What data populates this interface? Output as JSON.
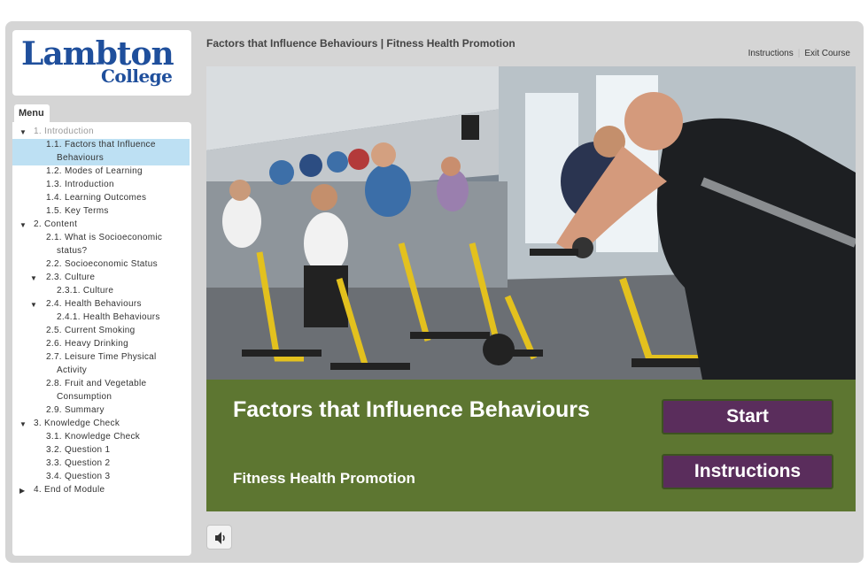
{
  "logo": {
    "line1": "Lambton",
    "line2": "College"
  },
  "menu": {
    "tab_label": "Menu",
    "items": [
      {
        "label": "1. Introduction",
        "level": 1,
        "arrow": "▼",
        "dim": true
      },
      {
        "label": "1.1. Factors that Influence",
        "level": 2,
        "active": true
      },
      {
        "label": "Behaviours",
        "level": 3,
        "cont": true,
        "active": true
      },
      {
        "label": "1.2. Modes of Learning",
        "level": 2
      },
      {
        "label": "1.3. Introduction",
        "level": 2
      },
      {
        "label": "1.4. Learning Outcomes",
        "level": 2
      },
      {
        "label": "1.5. Key Terms",
        "level": 2
      },
      {
        "label": "2. Content",
        "level": 1,
        "arrow": "▼"
      },
      {
        "label": "2.1. What is Socioeconomic",
        "level": 2
      },
      {
        "label": "status?",
        "level": 3,
        "cont": true
      },
      {
        "label": "2.2. Socioeconomic Status",
        "level": 2
      },
      {
        "label": "2.3. Culture",
        "level": 2,
        "arrow": "▼",
        "sub": true
      },
      {
        "label": "2.3.1. Culture",
        "level": 3
      },
      {
        "label": "2.4. Health Behaviours",
        "level": 2,
        "arrow": "▼",
        "sub": true
      },
      {
        "label": "2.4.1. Health Behaviours",
        "level": 3
      },
      {
        "label": "2.5. Current Smoking",
        "level": 2
      },
      {
        "label": "2.6. Heavy Drinking",
        "level": 2
      },
      {
        "label": "2.7. Leisure Time Physical",
        "level": 2
      },
      {
        "label": "Activity",
        "level": 3,
        "cont": true
      },
      {
        "label": "2.8. Fruit and Vegetable",
        "level": 2
      },
      {
        "label": "Consumption",
        "level": 3,
        "cont": true
      },
      {
        "label": "2.9. Summary",
        "level": 2
      },
      {
        "label": "3. Knowledge Check",
        "level": 1,
        "arrow": "▼"
      },
      {
        "label": "3.1. Knowledge Check",
        "level": 2
      },
      {
        "label": "3.2. Question 1",
        "level": 2
      },
      {
        "label": "3.3. Question 2",
        "level": 2
      },
      {
        "label": "3.4. Question 3",
        "level": 2
      },
      {
        "label": "4. End of Module",
        "level": 1,
        "arrow": "▶"
      }
    ]
  },
  "header": {
    "course_title": "Factors that Influence Behaviours | Fitness Health Promotion",
    "instructions_link": "Instructions",
    "exit_link": "Exit Course"
  },
  "slide": {
    "title": "Factors that Influence Behaviours",
    "subtitle": "Fitness Health Promotion",
    "start_label": "Start",
    "instructions_label": "Instructions"
  },
  "colors": {
    "banner": "#5d7631",
    "button": "#5a2d5c",
    "logo": "#1f4f9c",
    "active_menu": "#bde0f3"
  },
  "controls": {
    "audio_icon": "speaker-icon"
  }
}
